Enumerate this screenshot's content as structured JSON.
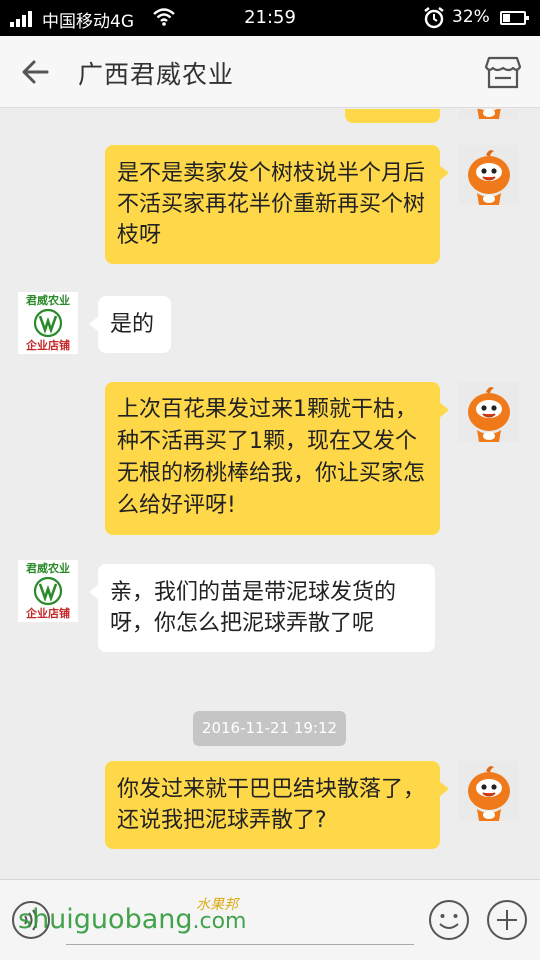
{
  "status_bar": {
    "carrier": "中国移动4G",
    "time": "21:59",
    "battery": "32%",
    "battery_level": 0.32
  },
  "header": {
    "title": "广西君威农业"
  },
  "messages": [
    {
      "from": "me",
      "text": "是不是卖家发个树枝说半个月后不活买家再花半价重新再买个树枝呀"
    },
    {
      "from": "them",
      "text": "是的"
    },
    {
      "from": "me",
      "text": "上次百花果发过来1颗就干枯，种不活再买了1颗，现在又发个无根的杨桃棒给我，你让买家怎么给好评呀!"
    },
    {
      "from": "them",
      "text": "亲，我们的苗是带泥球发货的呀，你怎么把泥球弄散了呢"
    },
    {
      "timestamp": "2016-11-21 19:12"
    },
    {
      "from": "me",
      "text": "你发过来就干巴巴结块散落了，还说我把泥球弄散了?"
    }
  ],
  "shop_avatar": {
    "top_text": "君威农业",
    "bottom_text": "企业店铺"
  },
  "watermark": {
    "brand": "shuiguobang",
    "suffix": ".com",
    "cn": "水果邦"
  },
  "colors": {
    "my_bubble": "#ffd84a",
    "their_bubble": "#ffffff",
    "background": "#ededed",
    "avatar_orange": "#f07a1a"
  },
  "icons": {
    "back": "arrow-left-icon",
    "shop": "storefront-icon",
    "voice": "voice-icon",
    "emoji": "smiley-icon",
    "plus": "plus-icon"
  }
}
